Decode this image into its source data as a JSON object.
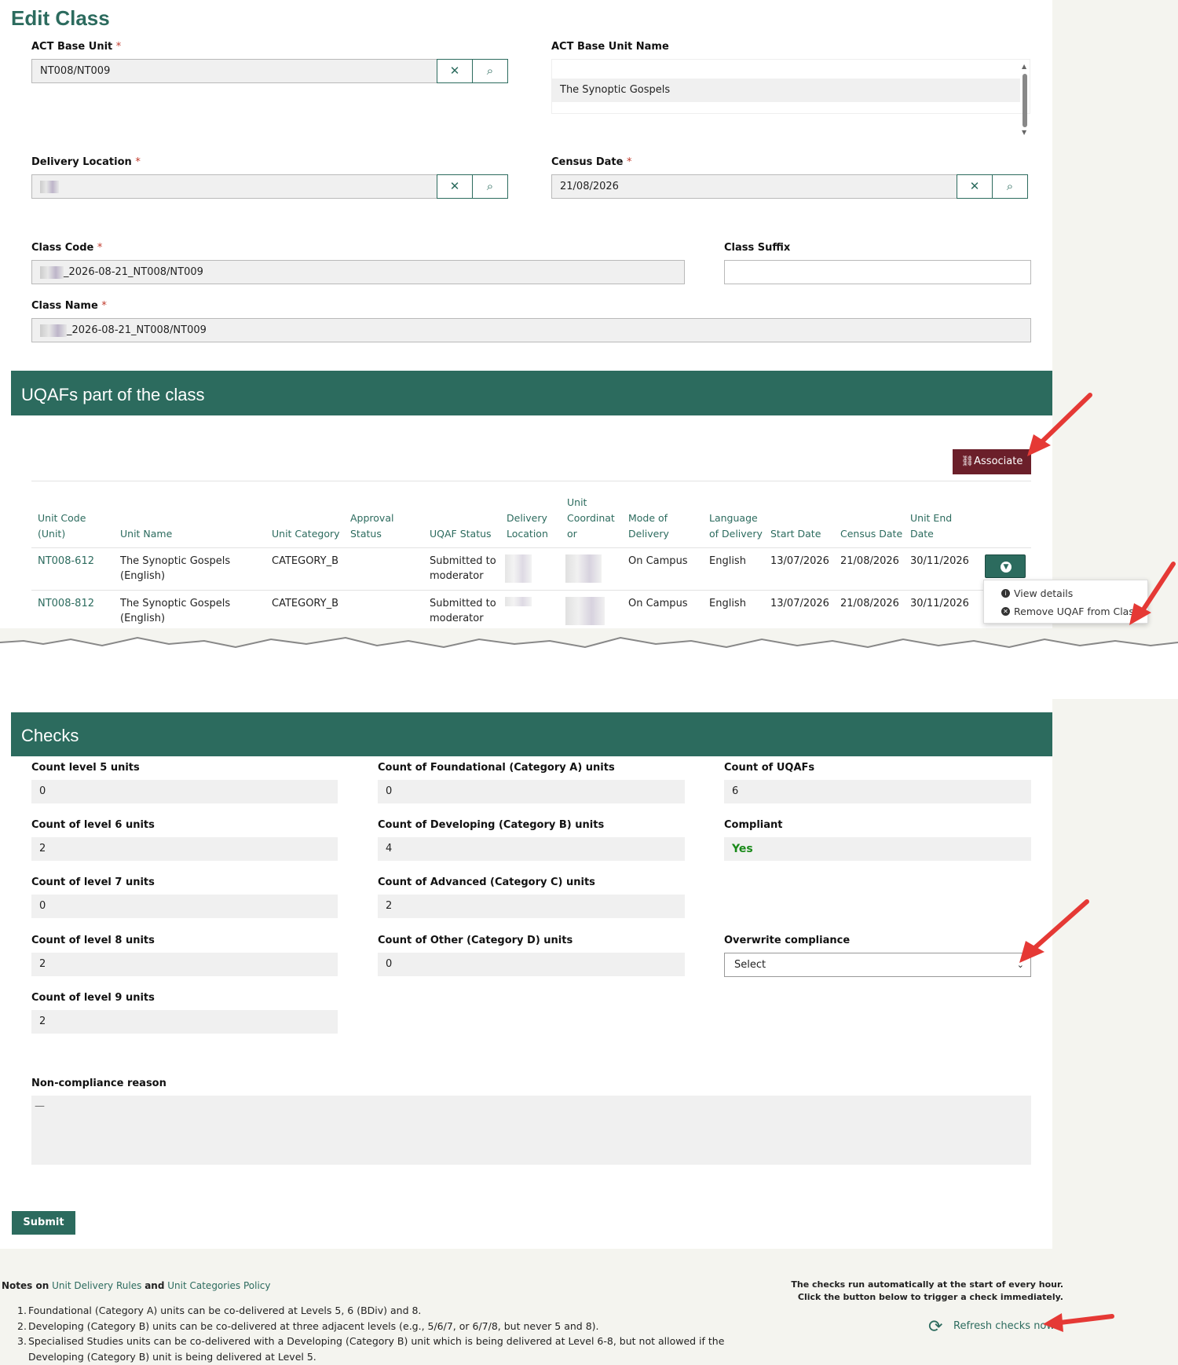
{
  "page": {
    "title": "Edit Class"
  },
  "form": {
    "act_base_unit": {
      "label": "ACT Base Unit",
      "value": "NT008/NT009"
    },
    "act_base_unit_name": {
      "label": "ACT Base Unit Name",
      "value": "The Synoptic Gospels"
    },
    "delivery_location": {
      "label": "Delivery Location",
      "value": ""
    },
    "census_date": {
      "label": "Census Date",
      "value": "21/08/2026"
    },
    "class_code": {
      "label": "Class Code",
      "value": "_2026-08-21_NT008/NT009"
    },
    "class_suffix": {
      "label": "Class Suffix",
      "value": ""
    },
    "class_name": {
      "label": "Class Name",
      "value": "_2026-08-21_NT008/NT009"
    },
    "required_mark": "*",
    "clear_glyph": "✕",
    "search_glyph": "⌕"
  },
  "uqafs": {
    "title": "UQAFs part of the class",
    "associate_label": "Associate",
    "headers": {
      "unit_code": [
        "Unit Code",
        "(Unit)"
      ],
      "unit_name": "Unit Name",
      "unit_category": "Unit Category",
      "approval_status": [
        "Approval",
        "Status"
      ],
      "uqaf_status": "UQAF Status",
      "delivery_location": [
        "Delivery",
        "Location"
      ],
      "unit_coord": [
        "Unit",
        "Coordinat",
        "or"
      ],
      "mode": [
        "Mode of",
        "Delivery"
      ],
      "language": [
        "Language",
        "of Delivery"
      ],
      "start_date": "Start Date",
      "census_date": "Census Date",
      "end_date": [
        "Unit End",
        "Date"
      ]
    },
    "rows": [
      {
        "code": "NT008-612",
        "name": [
          "The Synoptic Gospels",
          "(English)"
        ],
        "category": "CATEGORY_B",
        "uqaf_status": [
          "Submitted to",
          "moderator"
        ],
        "mode": "On Campus",
        "language": "English",
        "start": "13/07/2026",
        "census": "21/08/2026",
        "end": "30/11/2026"
      },
      {
        "code": "NT008-812",
        "name": [
          "The Synoptic Gospels",
          "(English)"
        ],
        "category": "CATEGORY_B",
        "uqaf_status": [
          "Submitted to",
          "moderator"
        ],
        "mode": "On Campus",
        "language": "English",
        "start": "13/07/2026",
        "census": "21/08/2026",
        "end": "30/11/2026"
      }
    ],
    "menu": {
      "view": "View details",
      "remove": "Remove UQAF from Class"
    }
  },
  "checks": {
    "title": "Checks",
    "level5": {
      "label": "Count level 5 units",
      "value": "0"
    },
    "level6": {
      "label": "Count of level 6 units",
      "value": "2"
    },
    "level7": {
      "label": "Count of level 7 units",
      "value": "0"
    },
    "level8": {
      "label": "Count of level 8 units",
      "value": "2"
    },
    "level9": {
      "label": "Count of level 9 units",
      "value": "2"
    },
    "cat_a": {
      "label": "Count of Foundational (Category A) units",
      "value": "0"
    },
    "cat_b": {
      "label": "Count of Developing (Category B) units",
      "value": "4"
    },
    "cat_c": {
      "label": "Count of Advanced (Category C) units",
      "value": "2"
    },
    "cat_d": {
      "label": "Count of Other (Category D) units",
      "value": "0"
    },
    "uqafs": {
      "label": "Count of UQAFs",
      "value": "6"
    },
    "compliant": {
      "label": "Compliant",
      "value": "Yes"
    },
    "overwrite": {
      "label": "Overwrite compliance",
      "value": "Select"
    },
    "reason": {
      "label": "Non-compliance reason",
      "value": "—"
    },
    "submit_label": "Submit"
  },
  "notes": {
    "prefix": "Notes on",
    "link1": "Unit Delivery Rules",
    "and": "and",
    "link2": "Unit Categories Policy",
    "items": [
      "Foundational (Category A) units can be co-delivered at Levels 5, 6 (BDiv) and 8.",
      "Developing (Category B) units can be co-delivered at three adjacent levels (e.g., 5/6/7, or 6/7/8, but never 5 and 8).",
      "Specialised Studies units can be co-delivered with a Developing (Category B) unit which is being delivered at Level 6-8, but not allowed if the",
      "Developing (Category B) unit is being delivered at Level 5."
    ],
    "auto_line1": "The checks run automatically at the start of every hour.",
    "auto_line2": "Click the button below to trigger a check immediately.",
    "refresh_label": "Refresh checks now"
  },
  "colors": {
    "accent": "#2c6b5e",
    "associate": "#6b1f2a",
    "annotation_arrow": "#e53935",
    "compliant_yes": "#1a8a1a"
  }
}
